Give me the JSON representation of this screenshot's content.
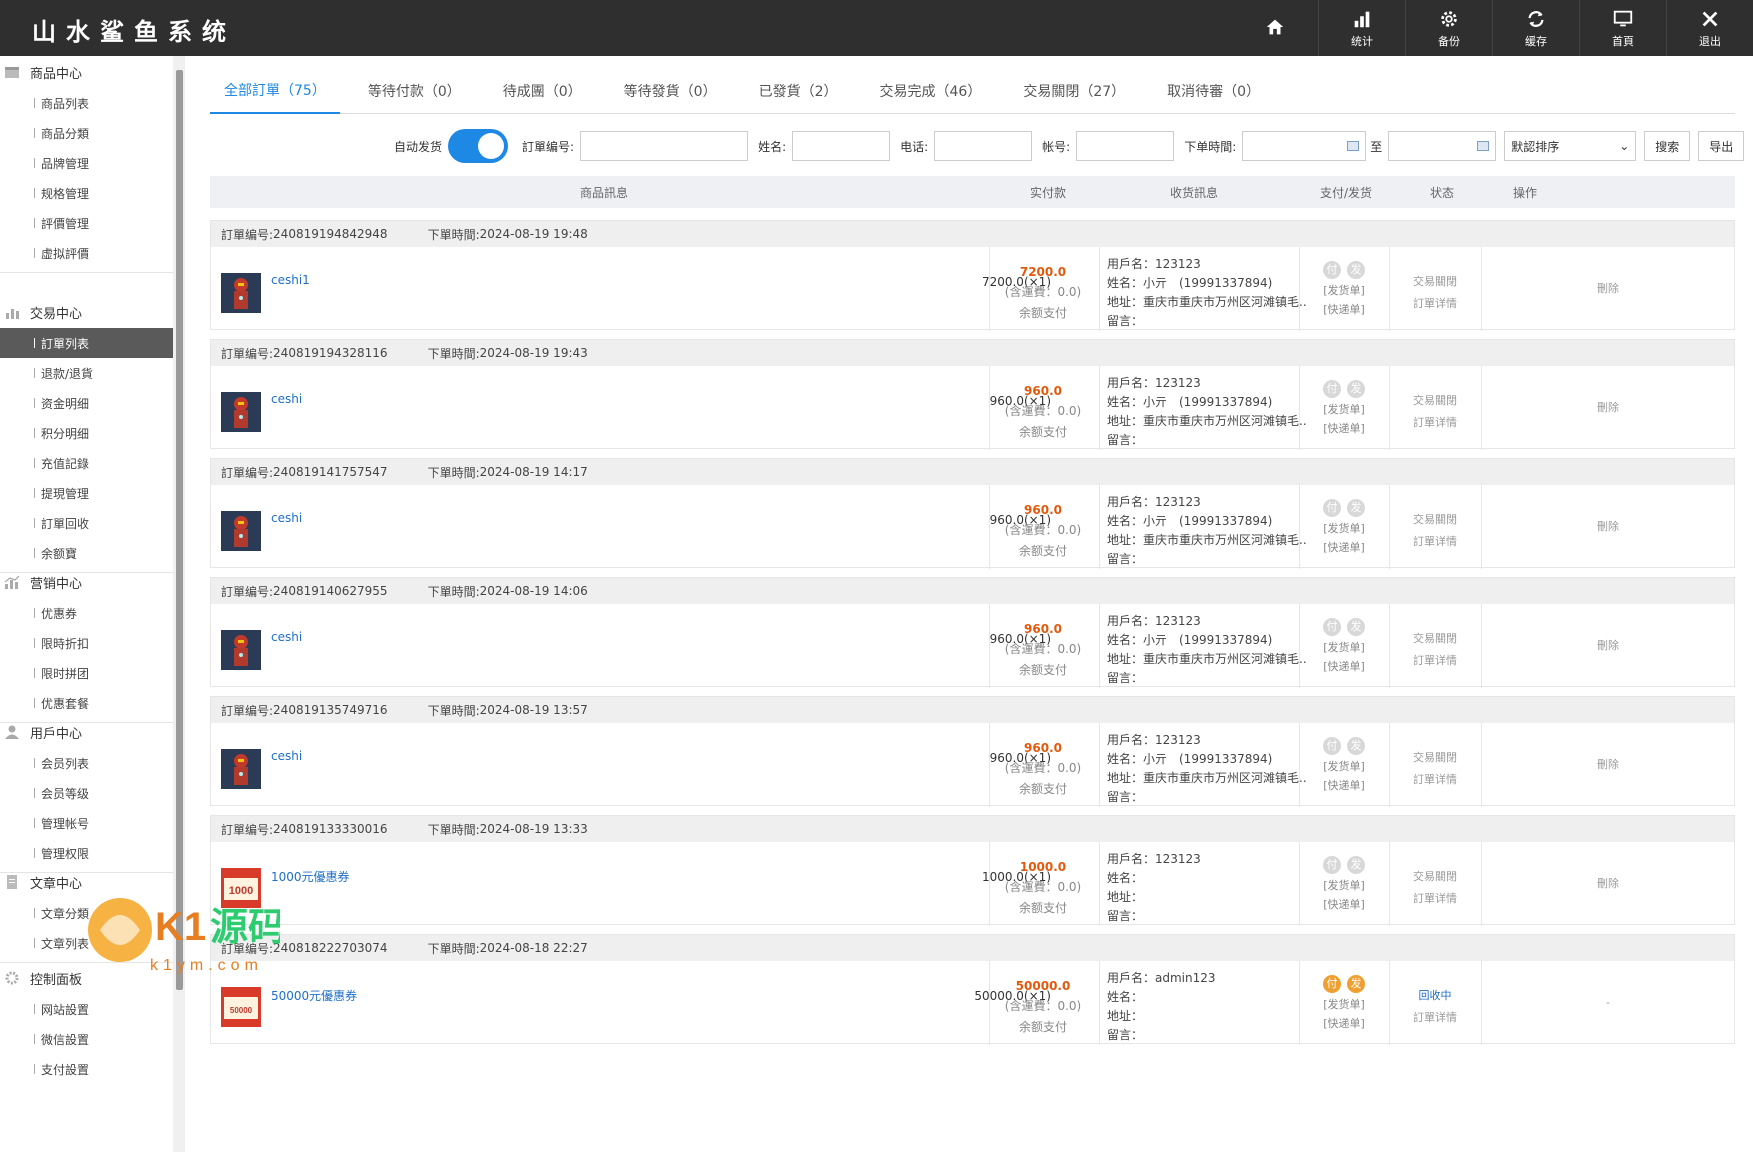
{
  "app": {
    "title": "山水鲨鱼系统"
  },
  "topnav": [
    {
      "label": "",
      "icon": "home-icon"
    },
    {
      "label": "统计",
      "icon": "stats-icon"
    },
    {
      "label": "备份",
      "icon": "gear-icon"
    },
    {
      "label": "缓存",
      "icon": "refresh-icon"
    },
    {
      "label": "首頁",
      "icon": "monitor-icon"
    },
    {
      "label": "退出",
      "icon": "close-icon"
    }
  ],
  "sidebar": {
    "groups": [
      {
        "title": "商品中心",
        "items": [
          "商品列表",
          "商品分類",
          "品牌管理",
          "规格管理",
          "評價管理",
          "虚拟評價"
        ]
      },
      {
        "title": "交易中心",
        "items": [
          "訂單列表",
          "退款/退貨",
          "资金明细",
          "积分明细",
          "充值記錄",
          "提現管理",
          "訂單回收",
          "余额寶"
        ]
      },
      {
        "title": "营销中心",
        "items": [
          "优惠券",
          "限時折扣",
          "限时拼团",
          "优惠套餐"
        ]
      },
      {
        "title": "用戶中心",
        "items": [
          "会员列表",
          "会员等级",
          "管理帐号",
          "管理权限"
        ]
      },
      {
        "title": "文章中心",
        "items": [
          "文章分類",
          "文章列表"
        ]
      },
      {
        "title": "控制面板",
        "items": [
          "网站設置",
          "微信設置",
          "支付設置"
        ]
      }
    ],
    "active_item": "訂單列表"
  },
  "tabs": [
    {
      "label": "全部訂單（75）"
    },
    {
      "label": "等待付款（0）"
    },
    {
      "label": "待成團（0）"
    },
    {
      "label": "等待發貨（0）"
    },
    {
      "label": "已發貨（2）"
    },
    {
      "label": "交易完成（46）"
    },
    {
      "label": "交易關閉（27）"
    },
    {
      "label": "取消待審（0）"
    }
  ],
  "filters": {
    "auto_ship_label": "自动发货",
    "order_no_label": "訂單编号:",
    "name_label": "姓名:",
    "phone_label": "电话:",
    "account_label": "帐号:",
    "time_label": "下单時間:",
    "to_label": "至",
    "sort_value": "默認排序",
    "search_label": "搜索",
    "export_label": "导出"
  },
  "table_headers": {
    "product": "商品訊息",
    "paid": "实付款",
    "receive": "收货訊息",
    "pay_ship": "支付/发货",
    "status": "状态",
    "op": "操作"
  },
  "orders": [
    {
      "order_label": "訂單编号:",
      "order_no": "240819194842948",
      "time_label": "下單時間:",
      "time": "2024-08-19 19:48",
      "product": "ceshi1",
      "price": "7200.0(×1)",
      "amount": "7200.0",
      "freight": "(含運費：0.0)",
      "pay_method": "余额支付",
      "user": "用戶名：123123",
      "name": "姓名：小亓　(19991337894)",
      "addr": "地址：重庆市重庆市万州区河滩镇毛..",
      "note": "留言：",
      "pay_badge": "付",
      "ship_badge": "发",
      "ship_doc": "[发货单]",
      "express_doc": "[快递单]",
      "status1": "交易關閉",
      "status2": "訂單详情",
      "op": "刪除"
    },
    {
      "order_label": "訂單编号:",
      "order_no": "240819194328116",
      "time_label": "下單時間:",
      "time": "2024-08-19 19:43",
      "product": "ceshi",
      "price": "960.0(×1)",
      "amount": "960.0",
      "freight": "(含運費：0.0)",
      "pay_method": "余额支付",
      "user": "用戶名：123123",
      "name": "姓名：小亓　(19991337894)",
      "addr": "地址：重庆市重庆市万州区河滩镇毛..",
      "note": "留言：",
      "pay_badge": "付",
      "ship_badge": "发",
      "ship_doc": "[发货单]",
      "express_doc": "[快递单]",
      "status1": "交易關閉",
      "status2": "訂單详情",
      "op": "刪除"
    },
    {
      "order_label": "訂單编号:",
      "order_no": "240819141757547",
      "time_label": "下單時間:",
      "time": "2024-08-19 14:17",
      "product": "ceshi",
      "price": "960.0(×1)",
      "amount": "960.0",
      "freight": "(含運費：0.0)",
      "pay_method": "余额支付",
      "user": "用戶名：123123",
      "name": "姓名：小亓　(19991337894)",
      "addr": "地址：重庆市重庆市万州区河滩镇毛..",
      "note": "留言：",
      "pay_badge": "付",
      "ship_badge": "发",
      "ship_doc": "[发货单]",
      "express_doc": "[快递单]",
      "status1": "交易關閉",
      "status2": "訂單详情",
      "op": "刪除"
    },
    {
      "order_label": "訂單编号:",
      "order_no": "240819140627955",
      "time_label": "下單時間:",
      "time": "2024-08-19 14:06",
      "product": "ceshi",
      "price": "960.0(×1)",
      "amount": "960.0",
      "freight": "(含運費：0.0)",
      "pay_method": "余额支付",
      "user": "用戶名：123123",
      "name": "姓名：小亓　(19991337894)",
      "addr": "地址：重庆市重庆市万州区河滩镇毛..",
      "note": "留言：",
      "pay_badge": "付",
      "ship_badge": "发",
      "ship_doc": "[发货单]",
      "express_doc": "[快递单]",
      "status1": "交易關閉",
      "status2": "訂單详情",
      "op": "刪除"
    },
    {
      "order_label": "訂單编号:",
      "order_no": "240819135749716",
      "time_label": "下單時間:",
      "time": "2024-08-19 13:57",
      "product": "ceshi",
      "price": "960.0(×1)",
      "amount": "960.0",
      "freight": "(含運費：0.0)",
      "pay_method": "余额支付",
      "user": "用戶名：123123",
      "name": "姓名：小亓　(19991337894)",
      "addr": "地址：重庆市重庆市万州区河滩镇毛..",
      "note": "留言：",
      "pay_badge": "付",
      "ship_badge": "发",
      "ship_doc": "[发货单]",
      "express_doc": "[快递单]",
      "status1": "交易關閉",
      "status2": "訂單详情",
      "op": "刪除"
    },
    {
      "order_label": "訂單编号:",
      "order_no": "240819133330016",
      "time_label": "下單時間:",
      "time": "2024-08-19 13:33",
      "product": "1000元優惠券",
      "price": "1000.0(×1)",
      "amount": "1000.0",
      "freight": "(含運費：0.0)",
      "pay_method": "余额支付",
      "user": "用戶名：123123",
      "name": "姓名：",
      "addr": "地址：",
      "note": "留言：",
      "pay_badge": "付",
      "ship_badge": "发",
      "ship_doc": "[发货单]",
      "express_doc": "[快递单]",
      "status1": "交易關閉",
      "status2": "訂單详情",
      "op": "刪除",
      "thumb_text": "1000"
    },
    {
      "order_label": "訂單编号:",
      "order_no": "240818222703074",
      "time_label": "下單時間:",
      "time": "2024-08-18 22:27",
      "product": "50000元優惠券",
      "price": "50000.0(×1)",
      "amount": "50000.0",
      "freight": "(含運費：0.0)",
      "pay_method": "余额支付",
      "user": "用戶名：admin123",
      "name": "姓名：",
      "addr": "地址：",
      "note": "留言：",
      "pay_badge": "付",
      "ship_badge": "发",
      "ship_doc": "[发货单]",
      "express_doc": "[快递单]",
      "status1": "回收中",
      "status2": "訂單详情",
      "op": "-",
      "thumb_text": "50000"
    }
  ],
  "watermark": {
    "brand": "K1源码",
    "url": "k1ym.com"
  },
  "colors": {
    "accent": "#1e88e5",
    "amount": "#e4580b",
    "topbar": "#2f2f2f",
    "badge_on": "#f0a030"
  }
}
